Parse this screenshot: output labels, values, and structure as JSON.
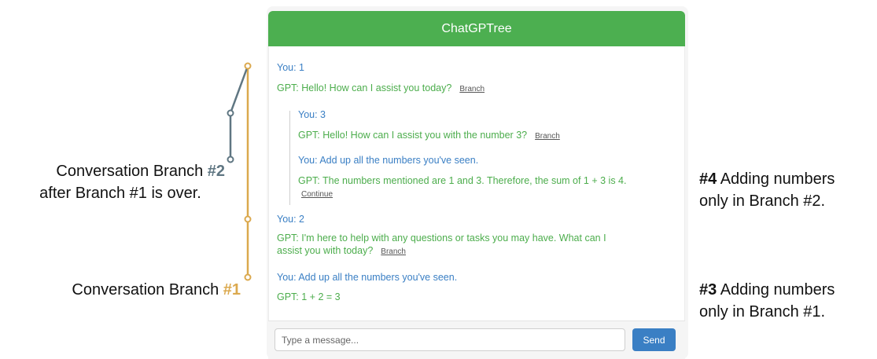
{
  "colors": {
    "header_green": "#4caf50",
    "you_blue": "#3a7fc4",
    "gpt_green": "#4cad4c",
    "branch1_gold": "#dba94e",
    "branch2_slate": "#5f7682"
  },
  "app": {
    "title": "ChatGPTree"
  },
  "messages": [
    {
      "speaker": "you",
      "text": "You: 1"
    },
    {
      "speaker": "gpt",
      "text": "GPT: Hello! How can I assist you today?",
      "action": "Branch"
    },
    {
      "speaker": "you",
      "text": "You: 3"
    },
    {
      "speaker": "gpt",
      "text": "GPT: Hello! How can I assist you with the number 3?",
      "action": "Branch"
    },
    {
      "speaker": "you",
      "text": "You: Add up all the numbers you've seen."
    },
    {
      "speaker": "gpt",
      "text": "GPT: The numbers mentioned are 1 and 3. Therefore, the sum of 1 + 3 is 4.",
      "action": "Continue"
    },
    {
      "speaker": "you",
      "text": "You: 2"
    },
    {
      "speaker": "gpt",
      "text_line1": "GPT: I'm here to help with any questions or tasks you may have. What can I",
      "text_line2": "assist you with today?",
      "action": "Branch"
    },
    {
      "speaker": "you",
      "text": "You: Add up all the numbers you've seen."
    },
    {
      "speaker": "gpt",
      "text": "GPT: 1 + 2 = 3"
    }
  ],
  "composer": {
    "placeholder": "Type a message...",
    "send_label": "Send"
  },
  "annotations": {
    "branch2": {
      "line1_prefix": "Conversation Branch ",
      "line1_tag": "#2",
      "line2": "after Branch #1 is over."
    },
    "branch1": {
      "prefix": "Conversation Branch ",
      "tag": "#1"
    },
    "note4": {
      "tag": "#4",
      "line1_rest": " Adding numbers",
      "line2": "only in Branch #2."
    },
    "note3": {
      "tag": "#3",
      "line1_rest": " Adding numbers",
      "line2": "only in Branch #1."
    }
  }
}
